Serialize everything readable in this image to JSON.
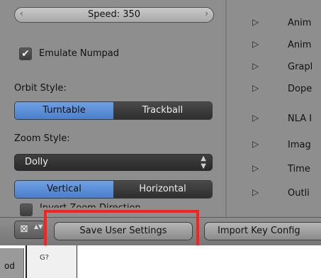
{
  "speed": {
    "label": "Speed: 350",
    "left_arrow": "‹",
    "right_arrow": "›"
  },
  "emulate_numpad": {
    "label": "Emulate Numpad",
    "checked": true,
    "check_glyph": "✔"
  },
  "orbit_style": {
    "label": "Orbit Style:",
    "options": [
      "Turntable",
      "Trackball"
    ],
    "selected": "Turntable"
  },
  "zoom_style": {
    "label": "Zoom Style:",
    "value": "Dolly",
    "caret_up": "▲",
    "caret_down": "▼"
  },
  "zoom_axis": {
    "options": [
      "Vertical",
      "Horizontal"
    ],
    "selected": "Vertical"
  },
  "partial_option": {
    "label": "Invert Zoom Direction"
  },
  "editor_list": {
    "triangle": "▷",
    "items": [
      "Anim",
      "Anim",
      "Grapl",
      "Dope",
      "NLA I",
      "Imag",
      "Time",
      "Outli"
    ]
  },
  "toolbar": {
    "editor_icon": "⊠",
    "editor_updown": "▲▼",
    "save_label": "Save User Settings",
    "import_label": "Import Key Config"
  },
  "lower": {
    "tab_text": "od",
    "line_number": "G?"
  },
  "colors": {
    "highlight": "#ff1f1f",
    "active_toggle": "#5b8fd8"
  }
}
